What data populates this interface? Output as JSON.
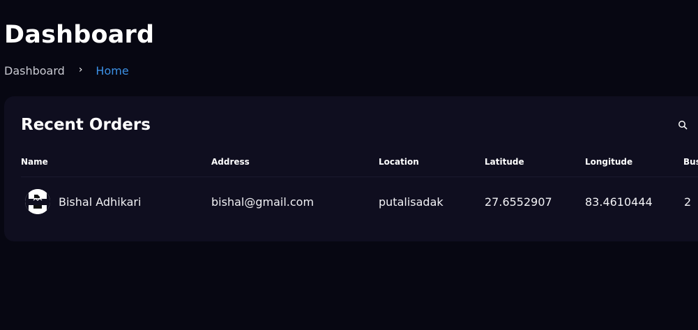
{
  "header": {
    "title": "Dashboard",
    "breadcrumb": {
      "root": "Dashboard",
      "separator_icon": "chevron-right-icon",
      "current": "Home"
    }
  },
  "orders": {
    "title": "Recent Orders",
    "search_icon": "search-icon",
    "columns": [
      "Name",
      "Address",
      "Location",
      "Latitude",
      "Longitude",
      "Bus"
    ],
    "rows": [
      {
        "avatar_icon": "broken-image-icon",
        "name": "Bishal Adhikari",
        "address": "bishal@gmail.com",
        "location": "putalisadak",
        "latitude": "27.6552907",
        "longitude": "83.4610444",
        "bus": "2"
      }
    ]
  },
  "colors": {
    "background": "#070712",
    "card": "#0f0e1f",
    "accent": "#3c91e6",
    "text": "#ffffff",
    "muted": "#c9cad2"
  }
}
